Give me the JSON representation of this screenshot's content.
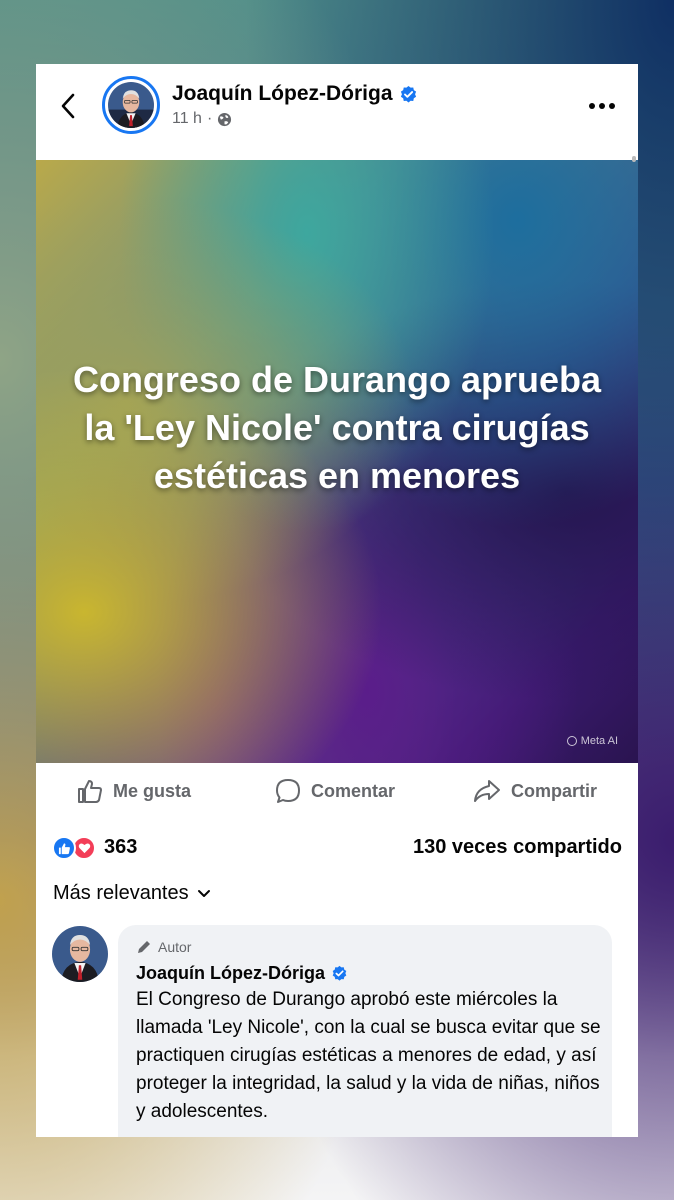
{
  "post": {
    "author": "Joaquín López-Dóriga",
    "time": "11 h",
    "separator": "·",
    "image_headline": "Congreso de Durango aprueba la 'Ley Nicole' contra cirugías estéticas en menores",
    "image_watermark": "Meta AI",
    "icons": [
      "back-chevron-icon",
      "verified-badge-icon",
      "globe-icon",
      "more-options-icon"
    ]
  },
  "actions": {
    "like": "Me gusta",
    "comment": "Comentar",
    "share": "Compartir"
  },
  "stats": {
    "reaction_count": "363",
    "shares": "130 veces compartido",
    "reactions": [
      "like",
      "love"
    ]
  },
  "comments": {
    "sort_label": "Más relevantes",
    "items": [
      {
        "badge": "Autor",
        "author": "Joaquín López-Dóriga",
        "text": "El Congreso de Durango aprobó este miércoles la llamada 'Ley Nicole', con la cual se busca evitar que se practiquen cirugías estéticas a menores de edad, y así proteger la integridad, la salud y la vida de niñas, niños y adolescentes."
      }
    ]
  },
  "colors": {
    "accent": "#1877f2",
    "love": "#f33e58",
    "secondary_text": "#65676b",
    "comment_bg": "#f0f2f5"
  }
}
